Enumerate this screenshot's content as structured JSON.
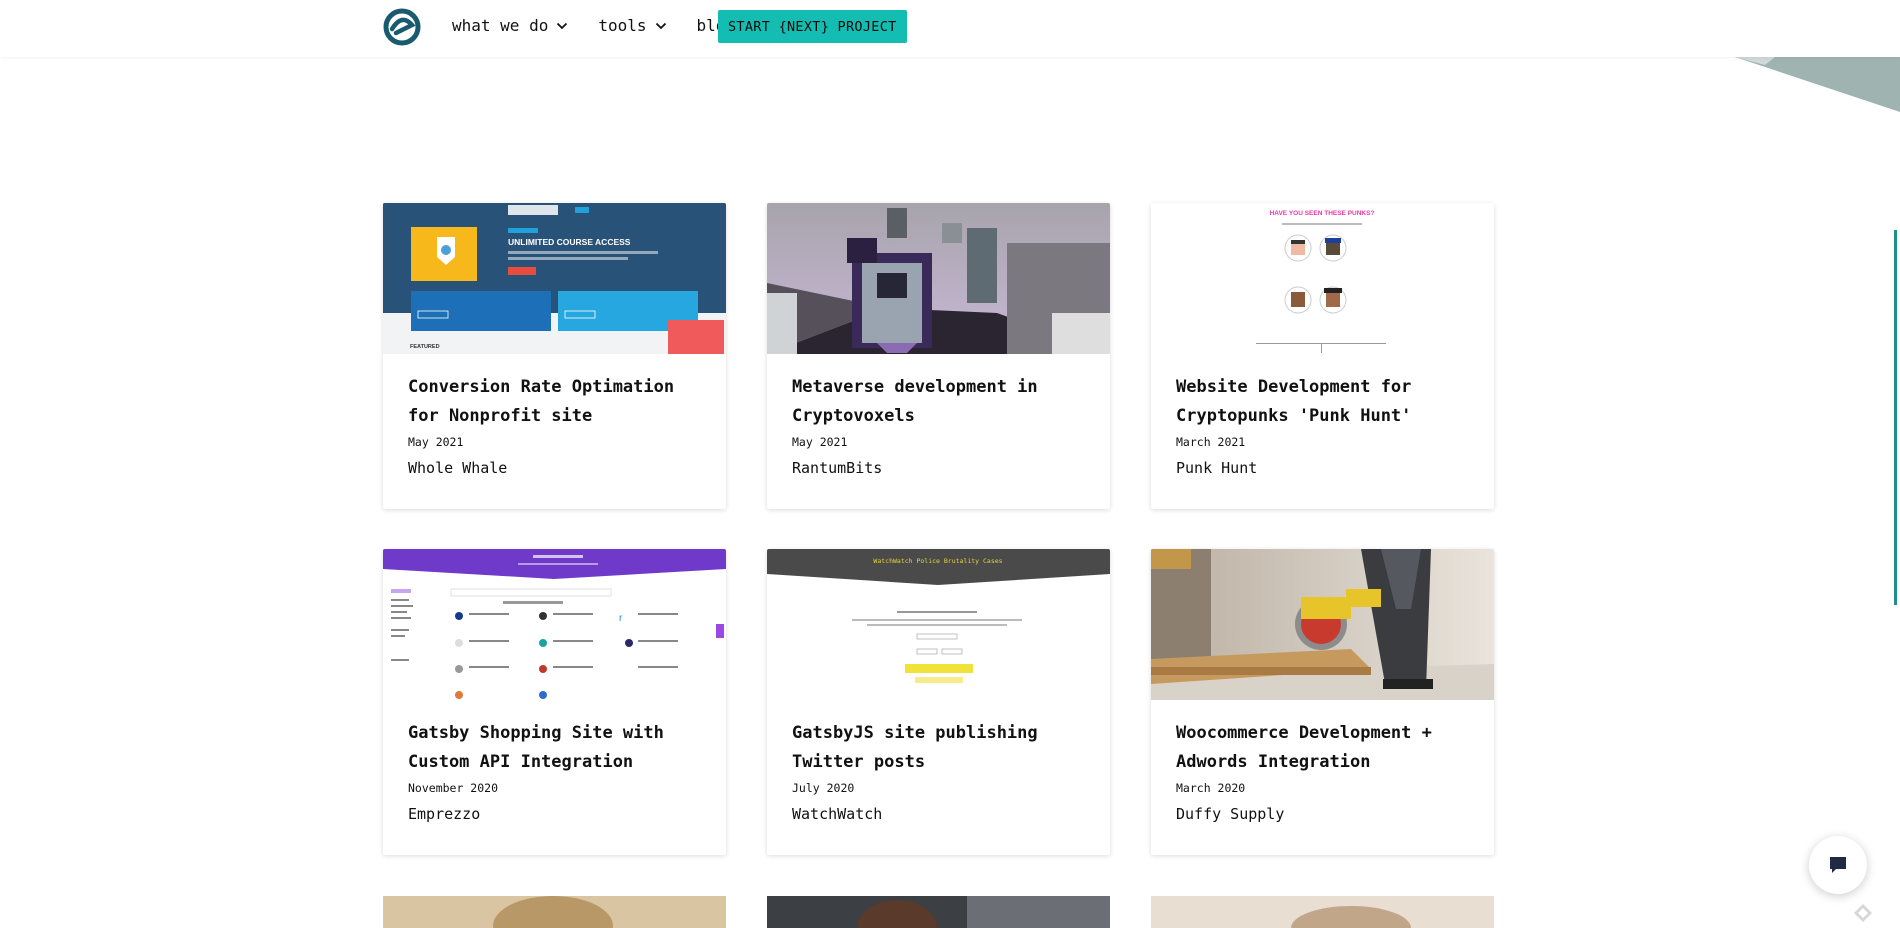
{
  "header": {
    "nav": [
      {
        "label": "what we do",
        "has_dropdown": true
      },
      {
        "label": "tools",
        "has_dropdown": true
      },
      {
        "label": "blog",
        "has_dropdown": false
      }
    ],
    "cta_label": "START {NEXT} PROJECT",
    "logo_icon": "logo-icon"
  },
  "projects": [
    {
      "title": "Conversion Rate Optimation for Nonprofit site",
      "date": "May 2021",
      "client": "Whole Whale"
    },
    {
      "title": "Metaverse development in Cryptovoxels",
      "date": "May 2021",
      "client": "RantumBits"
    },
    {
      "title": "Website Development for Cryptopunks 'Punk Hunt'",
      "date": "March 2021",
      "client": "Punk Hunt"
    },
    {
      "title": "Gatsby Shopping Site with Custom API Integration",
      "date": "November 2020",
      "client": "Emprezzo"
    },
    {
      "title": "GatsbyJS site publishing Twitter posts",
      "date": "July 2020",
      "client": "WatchWatch"
    },
    {
      "title": "Woocommerce Development + Adwords Integration",
      "date": "March 2020",
      "client": "Duffy Supply"
    }
  ],
  "thumbs": {
    "ww_badge": "UNLIMITED COURSE ACCESS",
    "ww_featured": "FEATURED",
    "punks_heading": "HAVE YOU SEEN THESE PUNKS?",
    "watch_heading": "WatchWatch Police Brutality Cases"
  },
  "colors": {
    "accent": "#14bdb2",
    "brand_dark": "#1a5a6e",
    "decor": "#9fb3b1"
  },
  "icons": {
    "chat": "chat-icon",
    "dropdown": "chevron-down-icon"
  }
}
